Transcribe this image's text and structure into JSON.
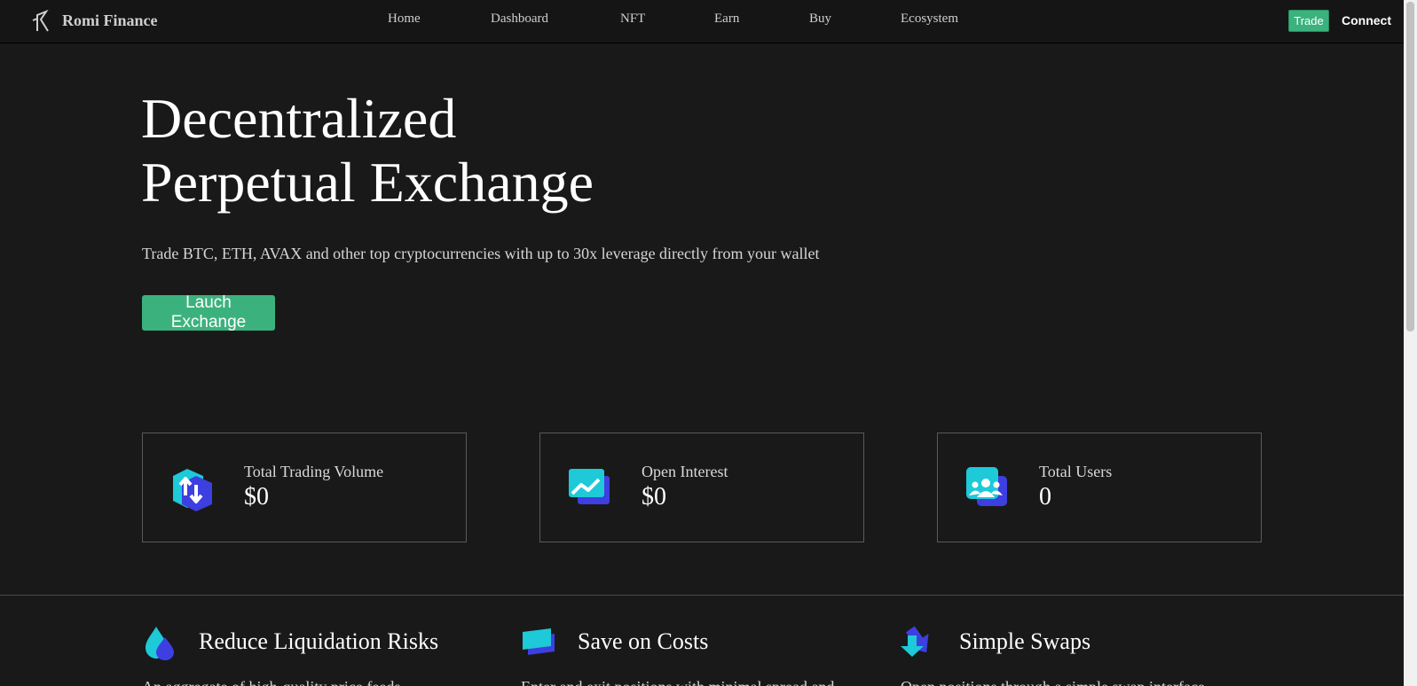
{
  "nav": {
    "brand": "Romi Finance",
    "brand_logo_icon": "romi-r-logo",
    "links": [
      "Home",
      "Dashboard",
      "NFT",
      "Earn",
      "Buy",
      "Ecosystem"
    ],
    "trade_label": "Trade",
    "connect_label": "Connect"
  },
  "hero": {
    "title_line1": "Decentralized",
    "title_line2": "Perpetual Exchange",
    "subtitle": "Trade BTC, ETH, AVAX and other top cryptocurrencies with up to 30x leverage directly from your wallet",
    "cta_label": "Lauch Exchange"
  },
  "stats": [
    {
      "label": "Total Trading Volume",
      "value": "$0",
      "icon": "trading-volume-icon"
    },
    {
      "label": "Open Interest",
      "value": "$0",
      "icon": "open-interest-icon"
    },
    {
      "label": "Total Users",
      "value": "0",
      "icon": "users-icon"
    }
  ],
  "features": [
    {
      "title": "Reduce Liquidation Risks",
      "text": "An aggregate of high-quality price feeds",
      "icon": "liquidity-drop-icon"
    },
    {
      "title": "Save on Costs",
      "text": "Enter and exit positions with minimal spread and",
      "icon": "cost-wallet-icon"
    },
    {
      "title": "Simple Swaps",
      "text": "Open positions through a simple swap interface",
      "icon": "swap-arrow-icon"
    }
  ],
  "colors": {
    "background": "#191919",
    "navbar": "#151515",
    "accent_green": "#3bb27d",
    "icon_cyan": "#1ec9d8",
    "icon_blue": "#3d3fe0"
  }
}
